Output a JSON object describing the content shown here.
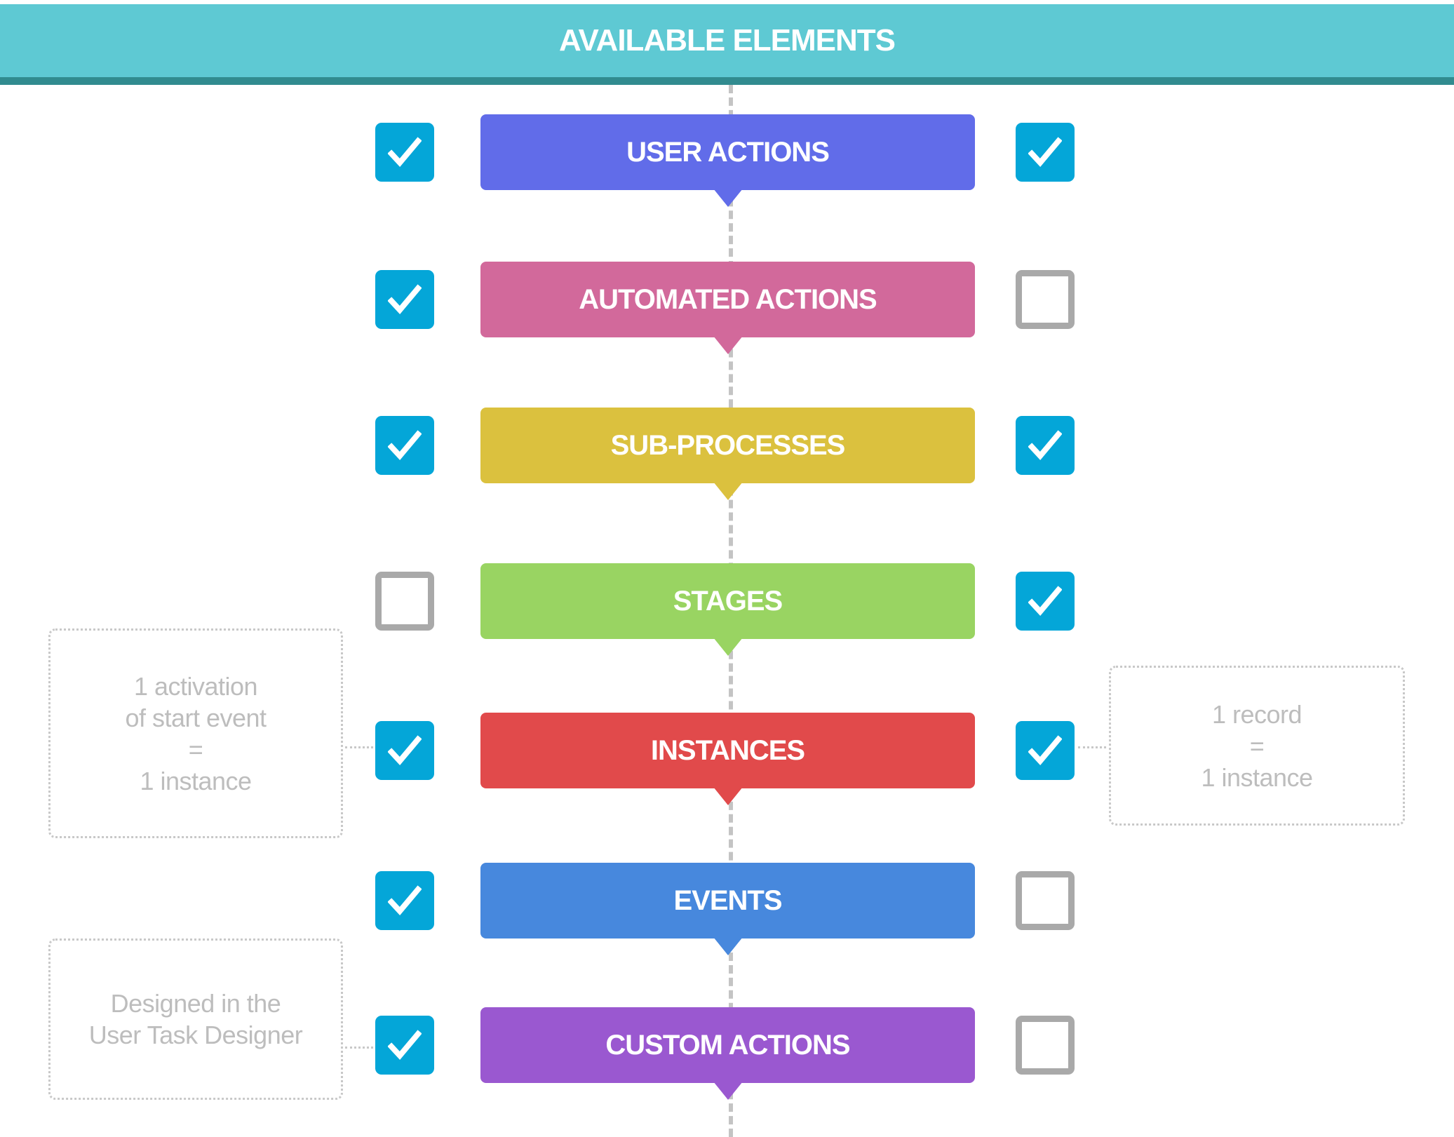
{
  "header": {
    "title": "AVAILABLE ELEMENTS",
    "color": "#5ec9d3",
    "band_color": "#318b8f"
  },
  "rows": [
    {
      "label": "USER ACTIONS",
      "color": "#616ce9",
      "left_checked": true,
      "right_checked": true
    },
    {
      "label": "AUTOMATED ACTIONS",
      "color": "#d2699b",
      "left_checked": true,
      "right_checked": false
    },
    {
      "label": "SUB-PROCESSES",
      "color": "#dbc13e",
      "left_checked": true,
      "right_checked": true
    },
    {
      "label": "STAGES",
      "color": "#99d462",
      "left_checked": false,
      "right_checked": true
    },
    {
      "label": "INSTANCES",
      "color": "#e14a4b",
      "left_checked": true,
      "right_checked": true
    },
    {
      "label": "EVENTS",
      "color": "#4788dd",
      "left_checked": true,
      "right_checked": false
    },
    {
      "label": "CUSTOM ACTIONS",
      "color": "#9a58d0",
      "left_checked": true,
      "right_checked": false
    }
  ],
  "notes": {
    "instances_left": {
      "lines": [
        "1 activation",
        "of start event",
        "=",
        "1 instance"
      ]
    },
    "instances_right": {
      "lines": [
        "1 record",
        "=",
        "1 instance"
      ]
    },
    "custom_actions_left": {
      "lines": [
        "Designed in the",
        "User Task Designer"
      ]
    }
  },
  "checkbox_colors": {
    "checked": "#04a6d8",
    "unchecked_border": "#a9a9a9"
  }
}
